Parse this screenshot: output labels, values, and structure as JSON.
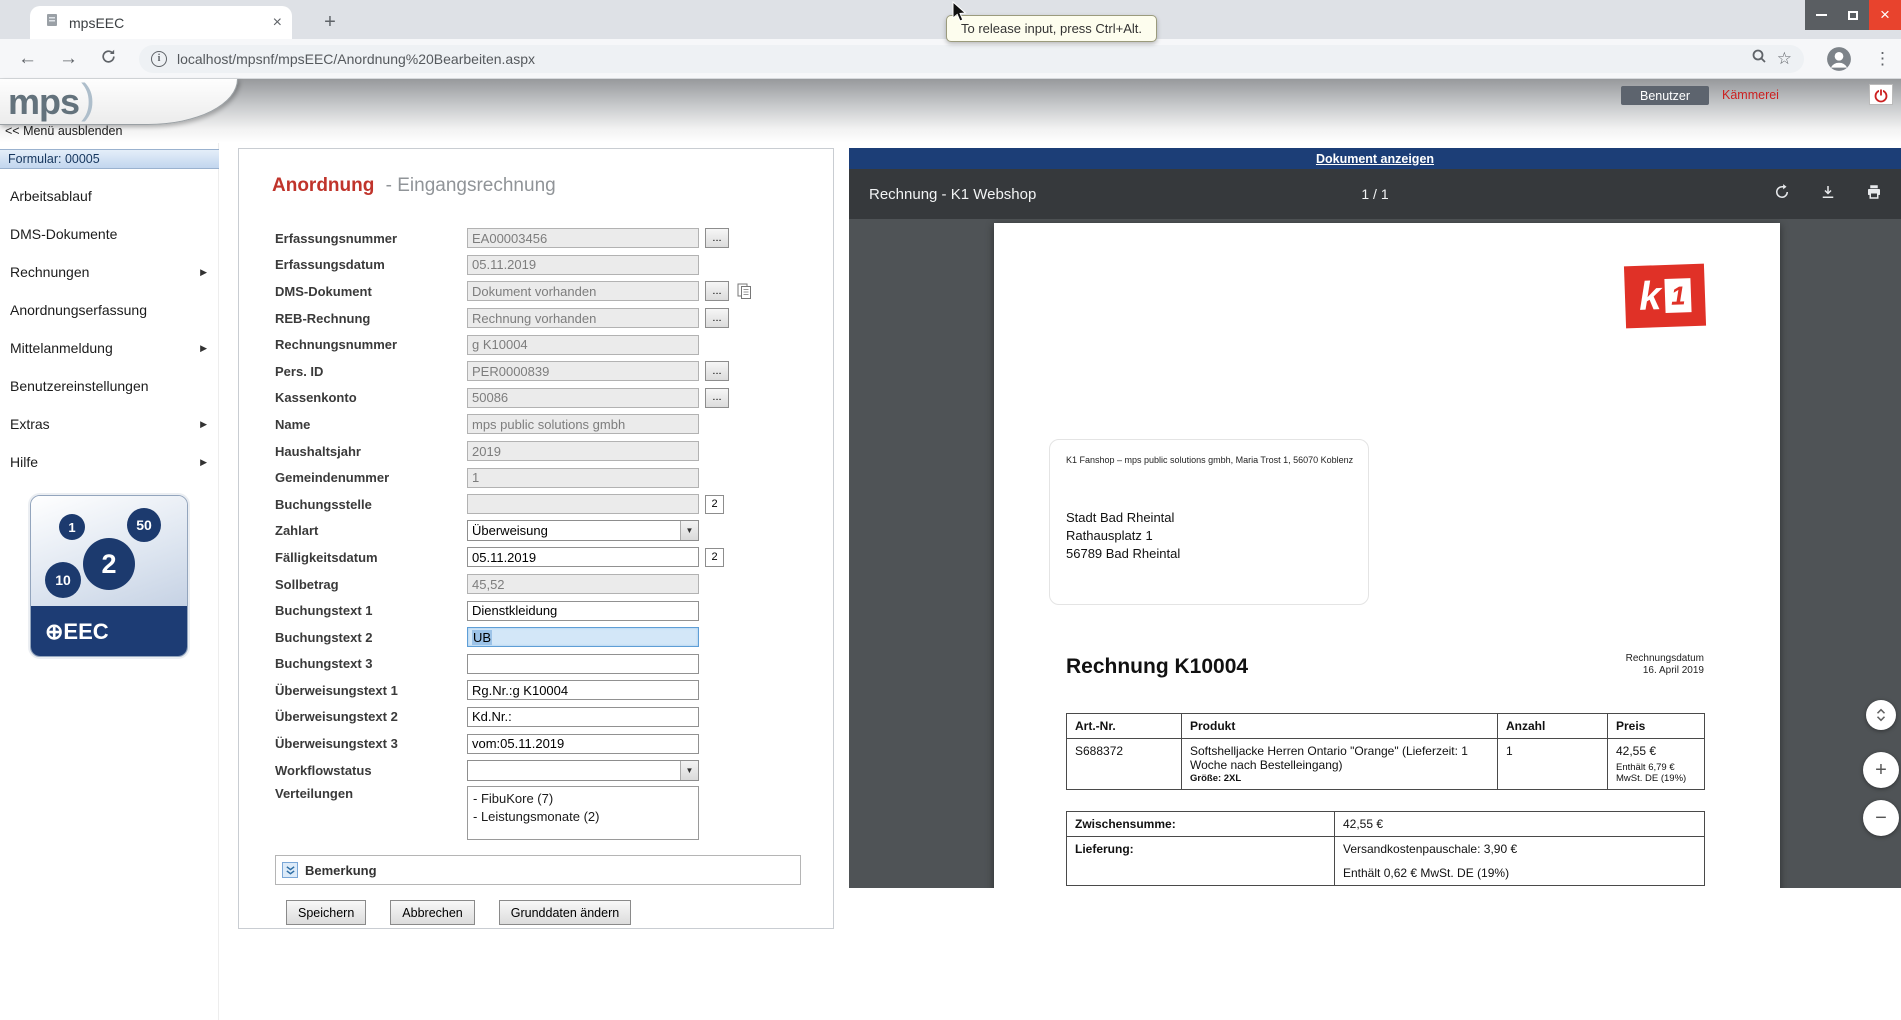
{
  "browser": {
    "tab_title": "mpsEEC",
    "url": "localhost/mpsnf/mpsEEC/Anordnung%20Bearbeiten.aspx",
    "tooltip": "To release input, press Ctrl+Alt."
  },
  "icons": {
    "back": "←",
    "forward": "→",
    "tab_close": "×",
    "window_close": "×",
    "new_tab": "+",
    "dots_menu": "⋮",
    "star": "☆",
    "select_arrow": "▼",
    "submenu_arrow": "▶",
    "info": "i",
    "zoom_in": "+",
    "zoom_out": "−"
  },
  "header": {
    "logo_text": "mps",
    "logo_paren": ")",
    "menu_hide": "<< Menü ausblenden",
    "user_button": "Benutzer",
    "department": "Kämmerei"
  },
  "sidebar": {
    "form_label": "Formular: 00005",
    "items": [
      {
        "label": "Arbeitsablauf"
      },
      {
        "label": "DMS-Dokumente"
      },
      {
        "label": "Rechnungen",
        "submenu": true
      },
      {
        "label": "Anordnungserfassung"
      },
      {
        "label": "Mittelanmeldung",
        "submenu": true
      },
      {
        "label": "Benutzereinstellungen"
      },
      {
        "label": "Extras",
        "submenu": true
      },
      {
        "label": "Hilfe",
        "submenu": true
      }
    ],
    "logo": {
      "numbers": [
        "1",
        "2",
        "50",
        "10"
      ],
      "text": "⊕EEC"
    }
  },
  "form": {
    "title": "Anordnung",
    "subtitle": "- Eingangsrechnung",
    "dots_label": "...",
    "btn2_label": "2",
    "fields": [
      {
        "label": "Erfassungsnummer",
        "value": "EA00003456",
        "type": "disabled"
      },
      {
        "label": "Erfassungsdatum",
        "value": "05.11.2019",
        "type": "disabled"
      },
      {
        "label": "DMS-Dokument",
        "value": "Dokument vorhanden",
        "type": "disabled"
      },
      {
        "label": "REB-Rechnung",
        "value": "Rechnung vorhanden",
        "type": "disabled"
      },
      {
        "label": "Rechnungsnummer",
        "value": "g K10004",
        "type": "disabled"
      },
      {
        "label": "Pers. ID",
        "value": "PER0000839",
        "type": "disabled"
      },
      {
        "label": "Kassenkonto",
        "value": "50086",
        "type": "disabled"
      },
      {
        "label": "Name",
        "value": "mps public solutions gmbh",
        "type": "disabled"
      },
      {
        "label": "Haushaltsjahr",
        "value": "2019",
        "type": "disabled"
      },
      {
        "label": "Gemeindenummer",
        "value": "1",
        "type": "disabled"
      },
      {
        "label": "Buchungsstelle",
        "value": "",
        "type": "disabled"
      },
      {
        "label": "Zahlart",
        "value": "Überweisung",
        "type": "select"
      },
      {
        "label": "Fälligkeitsdatum",
        "value": "05.11.2019",
        "type": "enabled"
      },
      {
        "label": "Sollbetrag",
        "value": "45,52",
        "type": "disabled"
      },
      {
        "label": "Buchungstext 1",
        "value": "Dienstkleidung",
        "type": "enabled"
      },
      {
        "label": "Buchungstext 2",
        "value": "UB",
        "type": "focused"
      },
      {
        "label": "Buchungstext 3",
        "value": "",
        "type": "enabled"
      },
      {
        "label": "Überweisungstext 1",
        "value": "Rg.Nr.:g K10004",
        "type": "enabled"
      },
      {
        "label": "Überweisungstext 2",
        "value": "Kd.Nr.:",
        "type": "enabled"
      },
      {
        "label": "Überweisungstext 3",
        "value": "vom:05.11.2019",
        "type": "enabled"
      },
      {
        "label": "Workflowstatus",
        "value": "",
        "type": "select"
      },
      {
        "label": "Verteilungen",
        "type": "listbox",
        "options": [
          "- FibuKore (7)",
          "- Leistungsmonate (2)"
        ]
      }
    ],
    "bemerkung_label": "Bemerkung",
    "buttons": [
      "Speichern",
      "Abbrechen",
      "Grunddaten ändern"
    ]
  },
  "pdf": {
    "doc_link": "Dokument anzeigen",
    "toolbar_title": "Rechnung - K1 Webshop",
    "page_indicator": "1 / 1",
    "invoice": {
      "logo_k": "k",
      "logo_1": "1",
      "sender_line": "K1 Fanshop – mps public solutions gmbh, Maria Trost 1, 56070 Koblenz",
      "recipient": [
        "Stadt Bad Rheintal",
        "Rathausplatz 1",
        "56789 Bad Rheintal"
      ],
      "title": "Rechnung K10004",
      "date_label": "Rechnungsdatum",
      "date_value": "16. April 2019",
      "table": {
        "headers": [
          "Art.-Nr.",
          "Produkt",
          "Anzahl",
          "Preis"
        ],
        "art_nr": "S688372",
        "produkt": "Softshelljacke Herren Ontario \"Orange\" (Lieferzeit: 1 Woche nach Bestelleingang)",
        "groesse": "Größe: 2XL",
        "anzahl": "1",
        "preis": "42,55 €",
        "preis_note": "Enthält 6,79 € MwSt. DE (19%)"
      },
      "totals": {
        "zwischensumme_label": "Zwischensumme:",
        "zwischensumme_value": "42,55 €",
        "lieferung_label": "Lieferung:",
        "lieferung_line1": "Versandkostenpauschale: 3,90 €",
        "lieferung_line2": "Enthält 0,62 € MwSt. DE (19%)"
      }
    }
  }
}
